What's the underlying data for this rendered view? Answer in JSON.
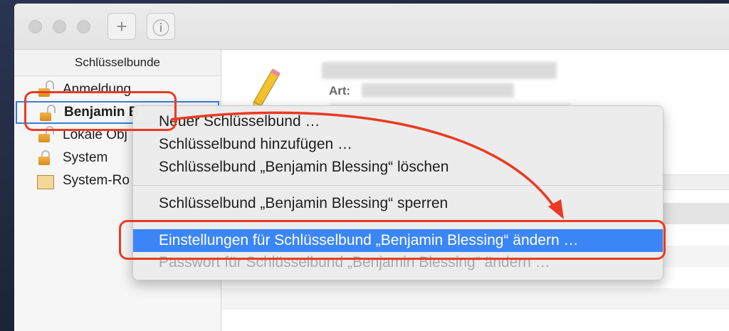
{
  "sidebar": {
    "header": "Schlüsselbunde",
    "items": [
      {
        "label": "Anmeldung",
        "icon": "unlocked-padlock-icon"
      },
      {
        "label": "Benjamin B",
        "icon": "unlocked-padlock-icon"
      },
      {
        "label": "Lokale Obj",
        "icon": "unlocked-padlock-icon"
      },
      {
        "label": "System",
        "icon": "padlock-icon"
      },
      {
        "label": "System-Ro",
        "icon": "certificate-icon"
      }
    ]
  },
  "toolbar": {
    "add_icon": "+",
    "info_icon": "ⓘ"
  },
  "detail": {
    "art_label": "Art:"
  },
  "context_menu": {
    "items": [
      "Neuer Schlüsselbund …",
      "Schlüsselbund hinzufügen …",
      "Schlüsselbund „Benjamin Blessing“ löschen",
      "Schlüsselbund „Benjamin Blessing“ sperren",
      "Einstellungen für Schlüsselbund „Benjamin Blessing“ ändern …",
      "Passwort für Schlüsselbund „Benjamin Blessing“ ändern …"
    ]
  },
  "colors": {
    "highlight": "#3b86f7",
    "annotation": "#ea3a22",
    "selection_border": "#3a7ed8"
  }
}
